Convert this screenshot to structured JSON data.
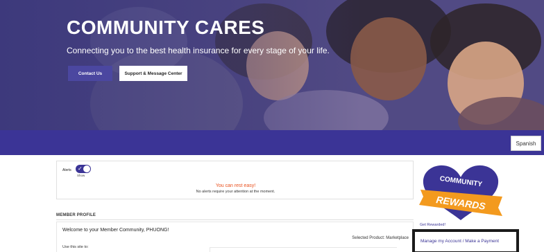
{
  "hero": {
    "title": "COMMUNITY CARES",
    "subtitle": "Connecting you to the best health insurance for every stage of your life.",
    "contact_button": "Contact Us",
    "support_button": "Support & Message Center"
  },
  "language_button": "Spanish",
  "alerts": {
    "label": "Alerts",
    "toggle_state": "Show",
    "status": "You can rest easy!",
    "message": "No alerts require your attention at the moment."
  },
  "member_profile": {
    "heading": "MEMBER PROFILE",
    "welcome": "Welcome to your Member Community, PHUONG!",
    "selected_product": "Selected Product: Marketplace",
    "use_site": "Use this site to:"
  },
  "rewards": {
    "line1": "COMMUNITY",
    "line2": "REWARDS",
    "get_rewarded": "Get Rewarded!",
    "manage_link": "Manage my Account / Make a Payment"
  },
  "colors": {
    "brand_purple": "#3b3496",
    "accent_orange": "#f39a1e",
    "alert_text": "#e94e1b"
  }
}
